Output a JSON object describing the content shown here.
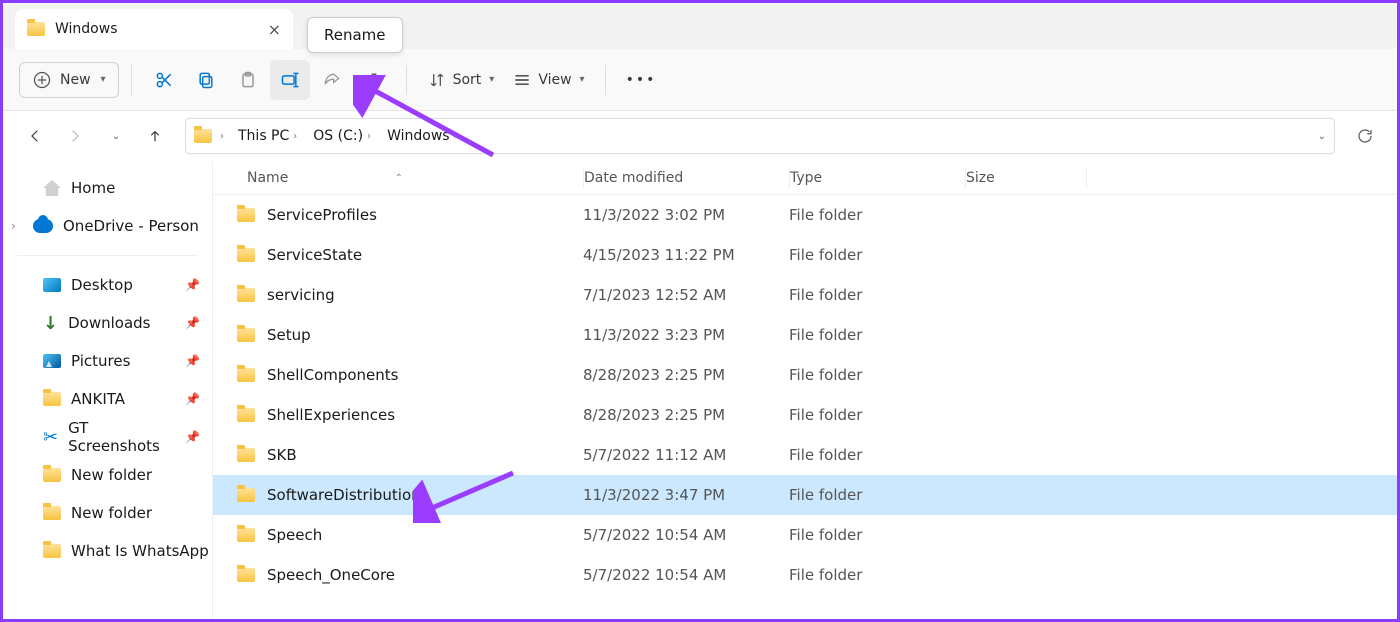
{
  "tab": {
    "title": "Windows"
  },
  "tooltip": "Rename",
  "toolbar": {
    "new_label": "New",
    "sort_label": "Sort",
    "view_label": "View"
  },
  "breadcrumbs": [
    "This PC",
    "OS (C:)",
    "Windows"
  ],
  "sidebar": {
    "home": "Home",
    "onedrive": "OneDrive - Person",
    "quick": [
      {
        "label": "Desktop"
      },
      {
        "label": "Downloads"
      },
      {
        "label": "Pictures"
      },
      {
        "label": "ANKITA"
      },
      {
        "label": "GT Screenshots"
      },
      {
        "label": "New folder"
      },
      {
        "label": "New folder"
      },
      {
        "label": "What Is WhatsApp"
      }
    ]
  },
  "columns": {
    "name": "Name",
    "date": "Date modified",
    "type": "Type",
    "size": "Size"
  },
  "rows": [
    {
      "name": "ServiceProfiles",
      "date": "11/3/2022 3:02 PM",
      "type": "File folder",
      "selected": false
    },
    {
      "name": "ServiceState",
      "date": "4/15/2023 11:22 PM",
      "type": "File folder",
      "selected": false
    },
    {
      "name": "servicing",
      "date": "7/1/2023 12:52 AM",
      "type": "File folder",
      "selected": false
    },
    {
      "name": "Setup",
      "date": "11/3/2022 3:23 PM",
      "type": "File folder",
      "selected": false
    },
    {
      "name": "ShellComponents",
      "date": "8/28/2023 2:25 PM",
      "type": "File folder",
      "selected": false
    },
    {
      "name": "ShellExperiences",
      "date": "8/28/2023 2:25 PM",
      "type": "File folder",
      "selected": false
    },
    {
      "name": "SKB",
      "date": "5/7/2022 11:12 AM",
      "type": "File folder",
      "selected": false
    },
    {
      "name": "SoftwareDistribution",
      "date": "11/3/2022 3:47 PM",
      "type": "File folder",
      "selected": true
    },
    {
      "name": "Speech",
      "date": "5/7/2022 10:54 AM",
      "type": "File folder",
      "selected": false
    },
    {
      "name": "Speech_OneCore",
      "date": "5/7/2022 10:54 AM",
      "type": "File folder",
      "selected": false
    }
  ]
}
